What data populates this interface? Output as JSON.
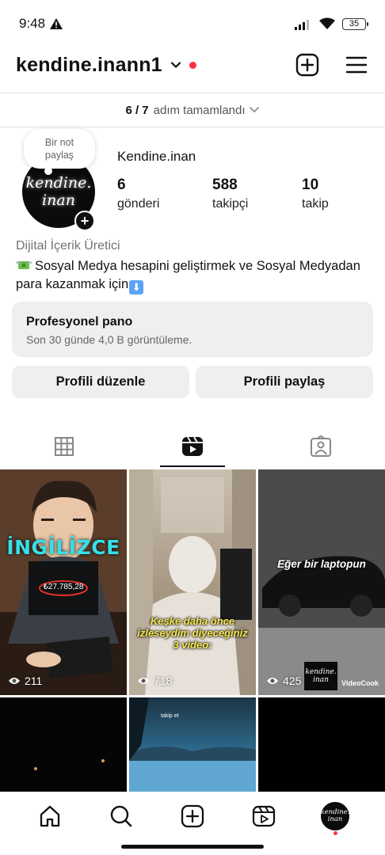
{
  "status_bar": {
    "time": "9:48",
    "battery": "35"
  },
  "header": {
    "username": "kendine.inann1"
  },
  "steps": {
    "count": "6 / 7",
    "text": "adım tamamlandı"
  },
  "note": {
    "line1": "Bir not",
    "line2": "paylaş"
  },
  "avatar": {
    "line1": "kendine.",
    "line2": "inan"
  },
  "profile": {
    "display_name": "Kendine.inan",
    "stats": [
      {
        "value": "6",
        "label": "gönderi"
      },
      {
        "value": "588",
        "label": "takipçi"
      },
      {
        "value": "10",
        "label": "takip"
      }
    ],
    "category": "Dijital İçerik Üretici",
    "bio": "Sosyal Medya hesapini geliştirmek ve Sosyal Medyadan para kazanmak için"
  },
  "pro_dashboard": {
    "title": "Profesyonel pano",
    "subtitle": "Son 30 günde 4,0 B görüntüleme."
  },
  "buttons": {
    "edit": "Profili düzenle",
    "share": "Profili paylaş"
  },
  "reels": [
    {
      "title": "İNGİLİZCE",
      "amount": "₺27.785,28",
      "views": "211"
    },
    {
      "caption": "Keşke daha önce izleseydim diyeceğiniz 3 video:",
      "views": "718"
    },
    {
      "caption": "Eğer bir laptopun",
      "views": "425",
      "badge_text": "kendine.",
      "badge_text2": "inan",
      "badge_label": "VideoCook"
    },
    {
      "views": ""
    },
    {
      "small_text": "takip et"
    },
    {
      "views": ""
    }
  ],
  "nav": {
    "avatar_line1": "kendine.",
    "avatar_line2": "inan"
  },
  "colors": {
    "accent_red": "#ff3040",
    "card_bg": "#efeff1"
  }
}
